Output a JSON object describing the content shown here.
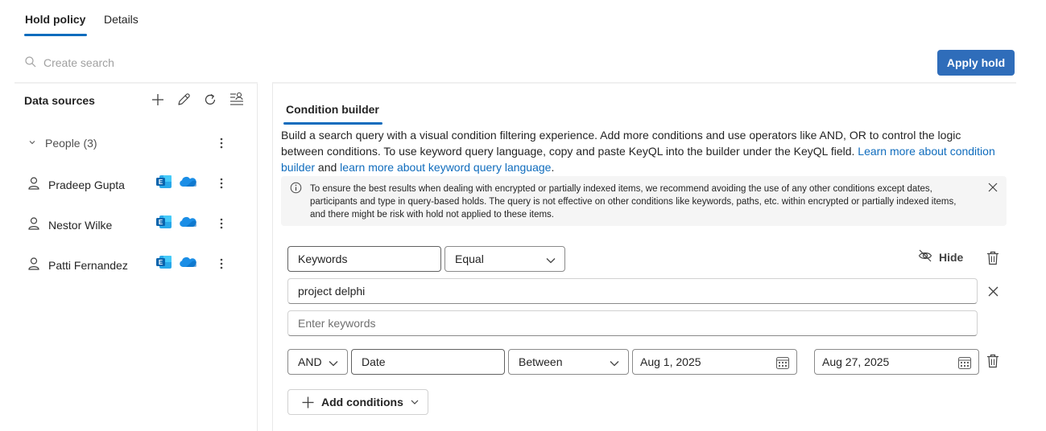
{
  "tabs": [
    {
      "label": "Hold policy",
      "active": true
    },
    {
      "label": "Details",
      "active": false
    }
  ],
  "search": {
    "placeholder": "Create search",
    "icon": "search-icon"
  },
  "apply_hold_label": "Apply hold",
  "data_sources": {
    "title": "Data sources",
    "toolbar_icons": [
      "add-icon",
      "edit-icon",
      "refresh-icon",
      "manage-icon"
    ],
    "group": {
      "label": "People (3)",
      "expanded": true
    },
    "people": [
      {
        "name": "Pradeep Gupta",
        "sources": [
          "exchange-icon",
          "onedrive-icon"
        ]
      },
      {
        "name": "Nestor Wilke",
        "sources": [
          "exchange-icon",
          "onedrive-icon"
        ]
      },
      {
        "name": "Patti Fernandez",
        "sources": [
          "exchange-icon",
          "onedrive-icon"
        ]
      }
    ]
  },
  "builder": {
    "tab_label": "Condition builder",
    "description": "Build a search query with a visual condition filtering experience. Add more conditions and use operators like AND, OR to control the logic between conditions. To use keyword query language, copy and paste KeyQL into the builder under the KeyQL field. ",
    "link1": "Learn more about condition builder",
    "and_text": " and ",
    "link2": "learn more about keyword query language",
    "period": ".",
    "info_text": "To ensure the best results when dealing with encrypted or partially indexed items, we recommend avoiding the use of any other conditions except dates, participants and type in query-based holds. The query is not effective on other conditions like keywords, paths, etc. within encrypted or partially indexed items, and there might be risk with hold not applied to these items.",
    "condition1": {
      "field": "Keywords",
      "operator": "Equal",
      "hide_label": "Hide",
      "value": "project delphi",
      "new_value_placeholder": "Enter keywords"
    },
    "condition2": {
      "logic": "AND",
      "field": "Date",
      "operator": "Between",
      "from": "Aug 1, 2025",
      "to": "Aug 27, 2025"
    },
    "add_conditions_label": "Add conditions"
  },
  "colors": {
    "accent": "#0f6cbd",
    "apply_button": "#2f6dba",
    "exchange": "#1a73c8",
    "onedrive": "#1b8ee6"
  }
}
